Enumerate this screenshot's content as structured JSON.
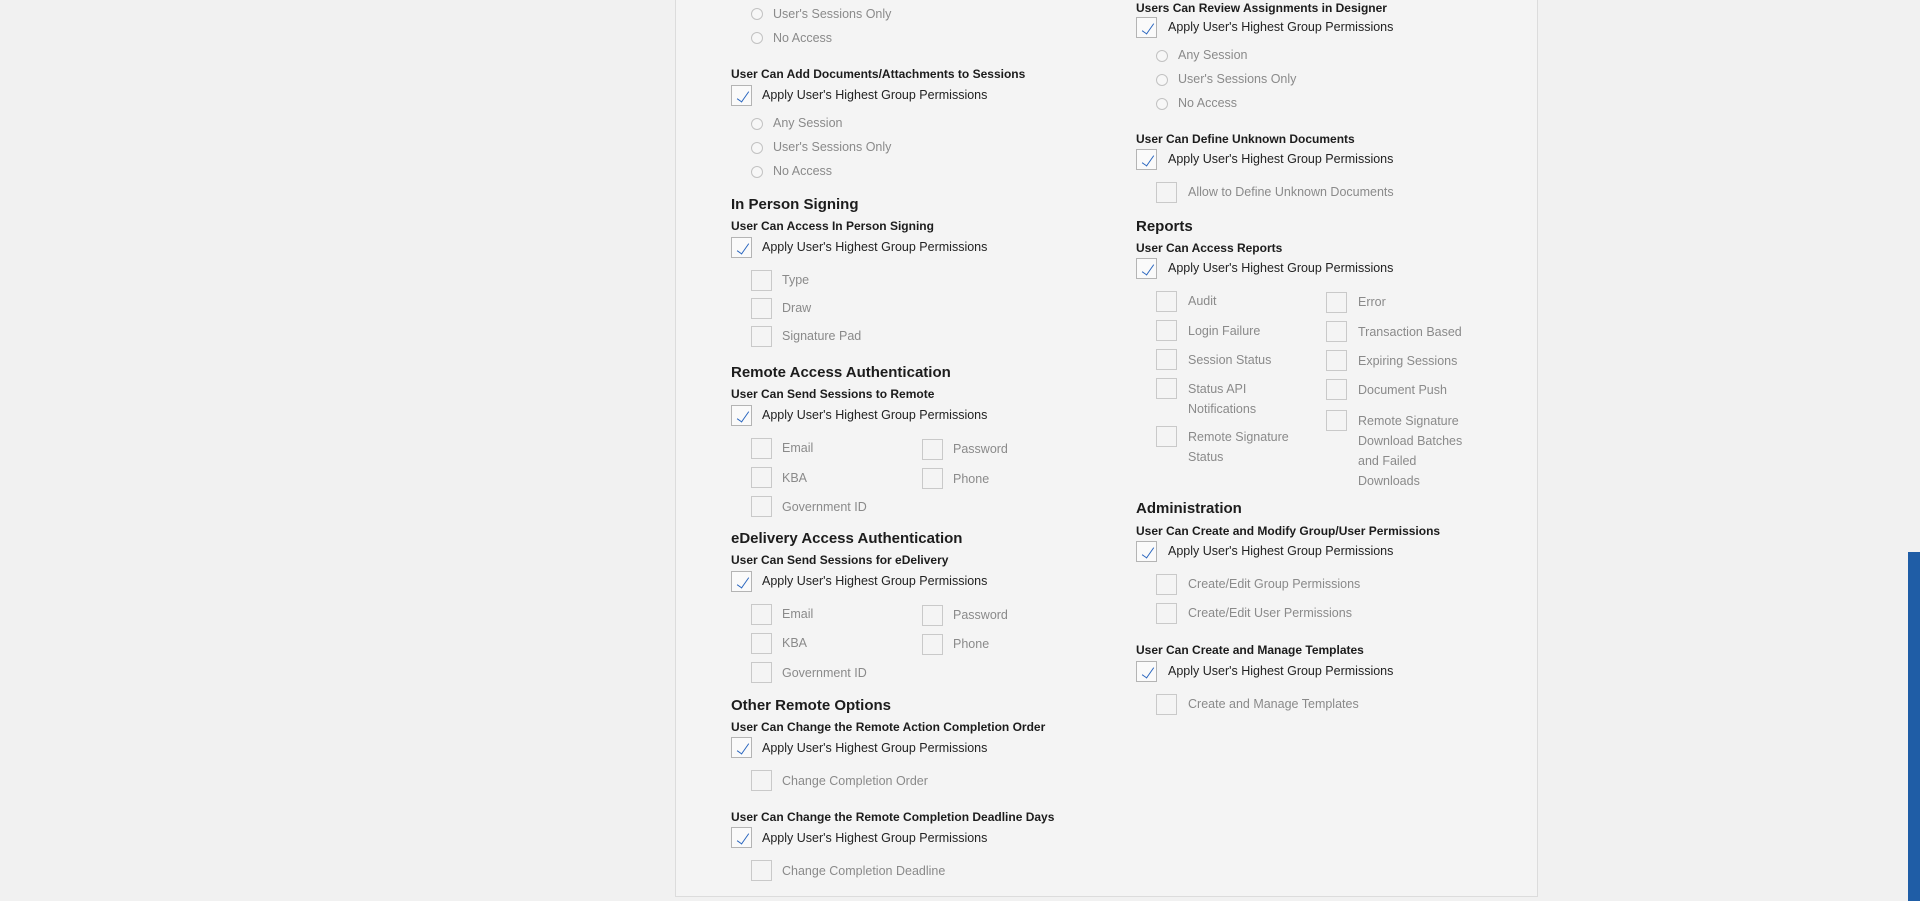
{
  "left": {
    "sessions_only_top": "User's Sessions Only",
    "no_access_top": "No Access",
    "add_docs_title": "User Can Add Documents/Attachments to Sessions",
    "apply_label": "Apply User's Highest Group Permissions",
    "any_session": "Any Session",
    "sessions_only": "User's Sessions Only",
    "no_access": "No Access",
    "in_person": {
      "heading": "In Person Signing",
      "sub": "User Can Access In Person Signing",
      "options": [
        "Type",
        "Draw",
        "Signature Pad"
      ]
    },
    "remote_auth": {
      "heading": "Remote Access Authentication",
      "sub": "User Can Send Sessions to Remote",
      "email": "Email",
      "password": "Password",
      "kba": "KBA",
      "phone": "Phone",
      "gov_id": "Government ID"
    },
    "edelivery_auth": {
      "heading": "eDelivery Access Authentication",
      "sub": "User Can Send Sessions for eDelivery",
      "email": "Email",
      "password": "Password",
      "kba": "KBA",
      "phone": "Phone",
      "gov_id": "Government ID"
    },
    "other_remote": {
      "heading": "Other Remote Options",
      "sub1": "User Can Change the Remote Action Completion Order",
      "opt1": "Change Completion Order",
      "sub2": "User Can Change the Remote Completion Deadline Days",
      "opt2": "Change Completion Deadline"
    }
  },
  "right": {
    "review_title": "Users Can Review Assignments in Designer",
    "apply_label": "Apply User's Highest Group Permissions",
    "any_session": "Any Session",
    "sessions_only": "User's Sessions Only",
    "no_access": "No Access",
    "define_title": "User Can Define Unknown Documents",
    "define_opt": "Allow to Define Unknown Documents",
    "reports": {
      "heading": "Reports",
      "sub": "User Can Access Reports",
      "audit": "Audit",
      "error": "Error",
      "login_failure": "Login Failure",
      "transaction_based": "Transaction Based",
      "session_status": "Session Status",
      "expiring_sessions": "Expiring Sessions",
      "status_api": "Status API Notifications",
      "document_push": "Document Push",
      "remote_sig_status": "Remote Signature Status",
      "remote_sig_download": "Remote Signature Download Batches and Failed Downloads"
    },
    "admin": {
      "heading": "Administration",
      "sub1": "User Can Create and Modify Group/User Permissions",
      "opt_group": "Create/Edit Group Permissions",
      "opt_user": "Create/Edit User Permissions",
      "sub2": "User Can Create and Manage Templates",
      "opt_templates": "Create and Manage Templates"
    }
  },
  "colors": {
    "check": "#2a66bf",
    "scrollbar": "#1f5da6",
    "panel": "#f4f4f4"
  }
}
